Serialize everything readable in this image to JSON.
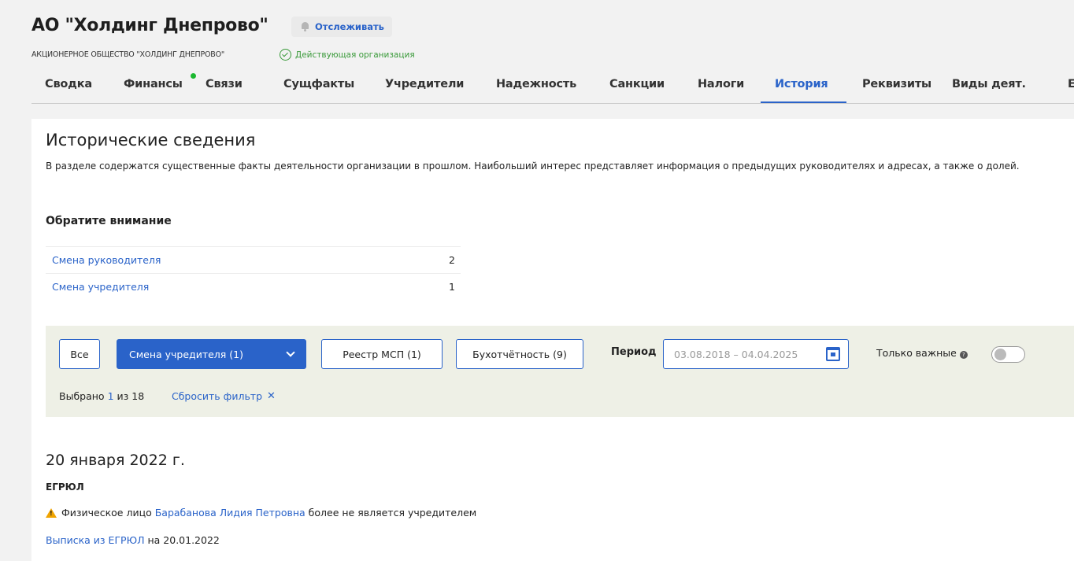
{
  "header": {
    "title": "АО \"Холдинг Днепрово\"",
    "follow_label": "Отслеживать",
    "full_name": "АКЦИОНЕРНОЕ ОБЩЕСТВО \"ХОЛДИНГ ДНЕПРОВО\"",
    "status": "Действующая организация"
  },
  "tabs": [
    {
      "label": "Сводка"
    },
    {
      "label": "Финансы"
    },
    {
      "label": "Связи"
    },
    {
      "label": "Сущфакты"
    },
    {
      "label": "Учредители"
    },
    {
      "label": "Надежность"
    },
    {
      "label": "Санкции"
    },
    {
      "label": "Налоги"
    },
    {
      "label": "История"
    },
    {
      "label": "Реквизиты"
    },
    {
      "label": "Виды деят."
    },
    {
      "label": "Е"
    }
  ],
  "section": {
    "title": "Исторические сведения",
    "description": "В разделе содержатся существенные факты деятельности организации в прошлом. Наибольший интерес представляет информация о предыдущих руководителях и адресах, а также о долей."
  },
  "attention": {
    "title": "Обратите внимание",
    "items": [
      {
        "label": "Смена руководителя",
        "count": "2"
      },
      {
        "label": "Смена учредителя",
        "count": "1"
      }
    ]
  },
  "filters": {
    "all_label": "Все",
    "selected_label": "Смена учредителя (1)",
    "msp_label": "Реестр МСП (1)",
    "accounting_label": "Бухотчётность (9)",
    "period_label": "Период",
    "period_value": "03.08.2018 – 04.04.2025",
    "important_label": "Только важные",
    "selected_prefix": "Выбрано",
    "selected_count": "1",
    "selected_suffix": "из 18",
    "reset_label": "Сбросить фильтр"
  },
  "event": {
    "date": "20 января 2022 г.",
    "source": "ЕГРЮЛ",
    "text_prefix": "Физическое лицо",
    "person": "Барабанова Лидия Петровна",
    "text_suffix": "более не является учредителем",
    "extract_link": "Выписка из ЕГРЮЛ",
    "extract_date": "на 20.01.2022"
  },
  "colors": {
    "accent": "#2a63c9",
    "success": "#3a9a3a",
    "warning": "#f0a400",
    "filter_bg": "#eef0e6"
  }
}
